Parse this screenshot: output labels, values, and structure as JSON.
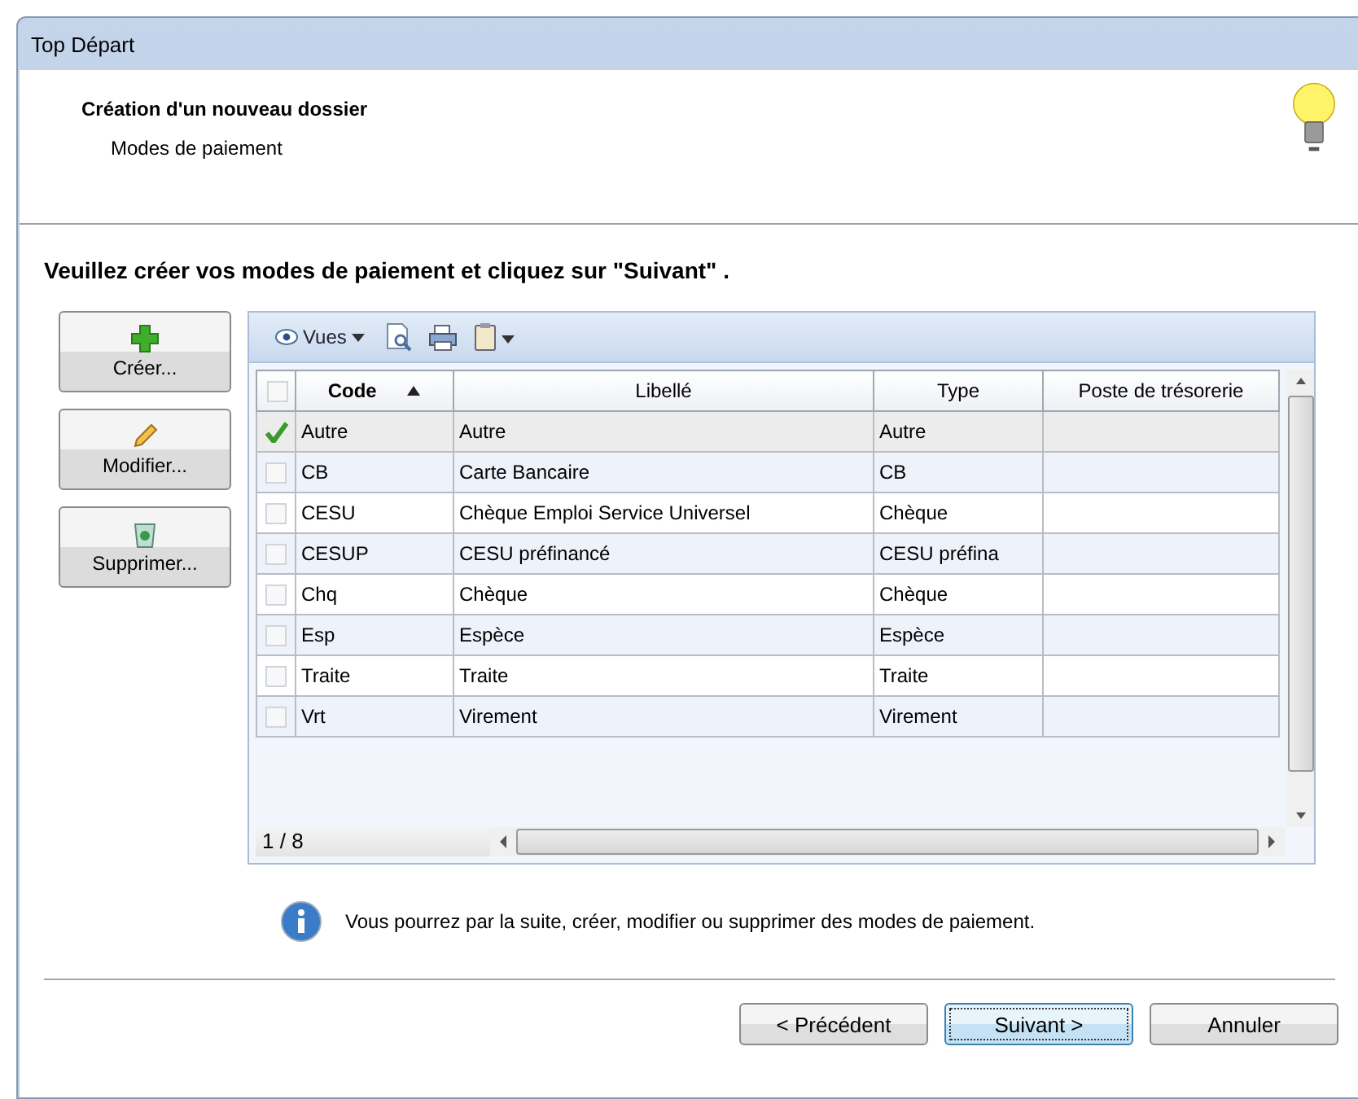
{
  "window": {
    "title": "Top Départ"
  },
  "header": {
    "title": "Création d'un nouveau dossier",
    "subtitle": "Modes de paiement"
  },
  "instruction": "Veuillez créer vos modes de paiement et cliquez sur \"Suivant\" .",
  "side_buttons": [
    {
      "label": "Créer...",
      "kind": "add"
    },
    {
      "label": "Modifier...",
      "kind": "edit"
    },
    {
      "label": "Supprimer...",
      "kind": "delete"
    }
  ],
  "toolbar": {
    "views_label": "Vues"
  },
  "table": {
    "all_checked": false,
    "columns": [
      {
        "label": "Code",
        "sorted": true
      },
      {
        "label": "Libellé",
        "sorted": false
      },
      {
        "label": "Type",
        "sorted": false
      },
      {
        "label": "Poste de trésorerie",
        "sorted": false
      }
    ],
    "rows": [
      {
        "checked": true,
        "selected": true,
        "cells": [
          "Autre",
          "Autre",
          "Autre"
        ]
      },
      {
        "checked": false,
        "selected": false,
        "cells": [
          "CB",
          "Carte Bancaire",
          "CB"
        ]
      },
      {
        "checked": false,
        "selected": false,
        "cells": [
          "CESU",
          "Chèque Emploi Service Universel",
          "Chèque"
        ]
      },
      {
        "checked": false,
        "selected": false,
        "cells": [
          "CESUP",
          "CESU préfinancé",
          "CESU préfina"
        ]
      },
      {
        "checked": false,
        "selected": false,
        "cells": [
          "Chq",
          "Chèque",
          "Chèque"
        ]
      },
      {
        "checked": false,
        "selected": false,
        "cells": [
          "Esp",
          "Espèce",
          "Espèce"
        ]
      },
      {
        "checked": false,
        "selected": false,
        "cells": [
          "Traite",
          "Traite",
          "Traite"
        ]
      },
      {
        "checked": false,
        "selected": false,
        "cells": [
          "Vrt",
          "Virement",
          "Virement"
        ]
      }
    ],
    "record_count": "1 / 8"
  },
  "info": "Vous pourrez par la suite, créer, modifier ou supprimer des modes de paiement.",
  "buttons": [
    {
      "label": "< Précédent",
      "default": false
    },
    {
      "label": "Suivant >",
      "default": true
    },
    {
      "label": "Annuler",
      "default": false
    }
  ]
}
